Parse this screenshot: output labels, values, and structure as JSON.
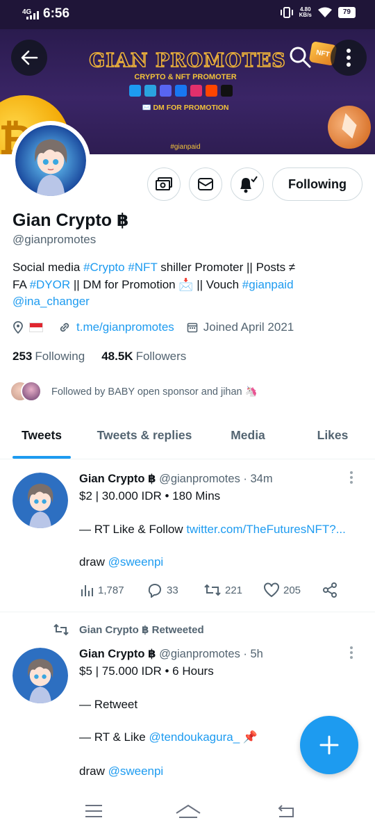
{
  "status_bar": {
    "network": "4G",
    "time": "6:56",
    "speed_value": "4.80",
    "speed_unit": "KB/s",
    "battery": "79"
  },
  "banner": {
    "title": "GIAN PROMOTES",
    "subtitle": "CRYPTO & NFT PROMOTER",
    "dm_text": "✉️ DM FOR PROMOTION",
    "hashtag": "#gianpaid",
    "badge": "NFT",
    "socials": [
      "twitter-icon",
      "telegram-icon",
      "discord-icon",
      "facebook-icon",
      "instagram-icon",
      "reddit-icon",
      "tiktok-icon"
    ],
    "social_colors": [
      "#1d9bf0",
      "#2aa3df",
      "#5865f2",
      "#1877f2",
      "#e1306c",
      "#ff4500",
      "#111111"
    ]
  },
  "profile": {
    "name": "Gian Crypto ฿",
    "handle": "@gianpromotes",
    "follow_label": "Following",
    "bio": {
      "t1": "Social media ",
      "tag_crypto": "#Crypto",
      "t2": " ",
      "tag_nft": "#NFT",
      "t3": " shiller Promoter || Posts ≠",
      "t4": "FA ",
      "tag_dyor": "#DYOR",
      "t5": " || DM for Promotion 📩 || Vouch ",
      "tag_gianpaid": "#gianpaid",
      "mention": "@ina_changer"
    },
    "link": "t.me/gianpromotes",
    "joined": "Joined April 2021",
    "following_count": "253",
    "following_label": "Following",
    "followers_count": "48.5K",
    "followers_label": "Followers",
    "followed_by": "Followed by BABY open sponsor and jihan 🦄"
  },
  "tabs": [
    "Tweets",
    "Tweets & replies",
    "Media",
    "Likes"
  ],
  "tweets": [
    {
      "name": "Gian Crypto ฿",
      "handle": "@gianpromotes",
      "time": "· 34m",
      "line1": "$2 | 30.000 IDR • 180 Mins",
      "line2_prefix": "— RT Like & Follow ",
      "line2_link": "twitter.com/TheFuturesNFT?...",
      "line3_prefix": "draw ",
      "line3_link": "@sweenpi",
      "views": "1,787",
      "replies": "33",
      "retweets": "221",
      "likes": "205"
    },
    {
      "retweet_label": "Gian Crypto ฿ Retweeted",
      "name": "Gian Crypto ฿",
      "handle": "@gianpromotes",
      "time": "· 5h",
      "line1": "$5 | 75.000 IDR • 6 Hours",
      "line2": "— Retweet",
      "line3_prefix": "— RT & Like ",
      "line3_link": "@tendoukagura_",
      "line3_suffix": " 📌",
      "line4_prefix": "draw ",
      "line4_link": "@sweenpi"
    }
  ],
  "colors": {
    "accent": "#1d9bf0",
    "banner_bg": "#2a1b4e",
    "muted": "#536471"
  }
}
